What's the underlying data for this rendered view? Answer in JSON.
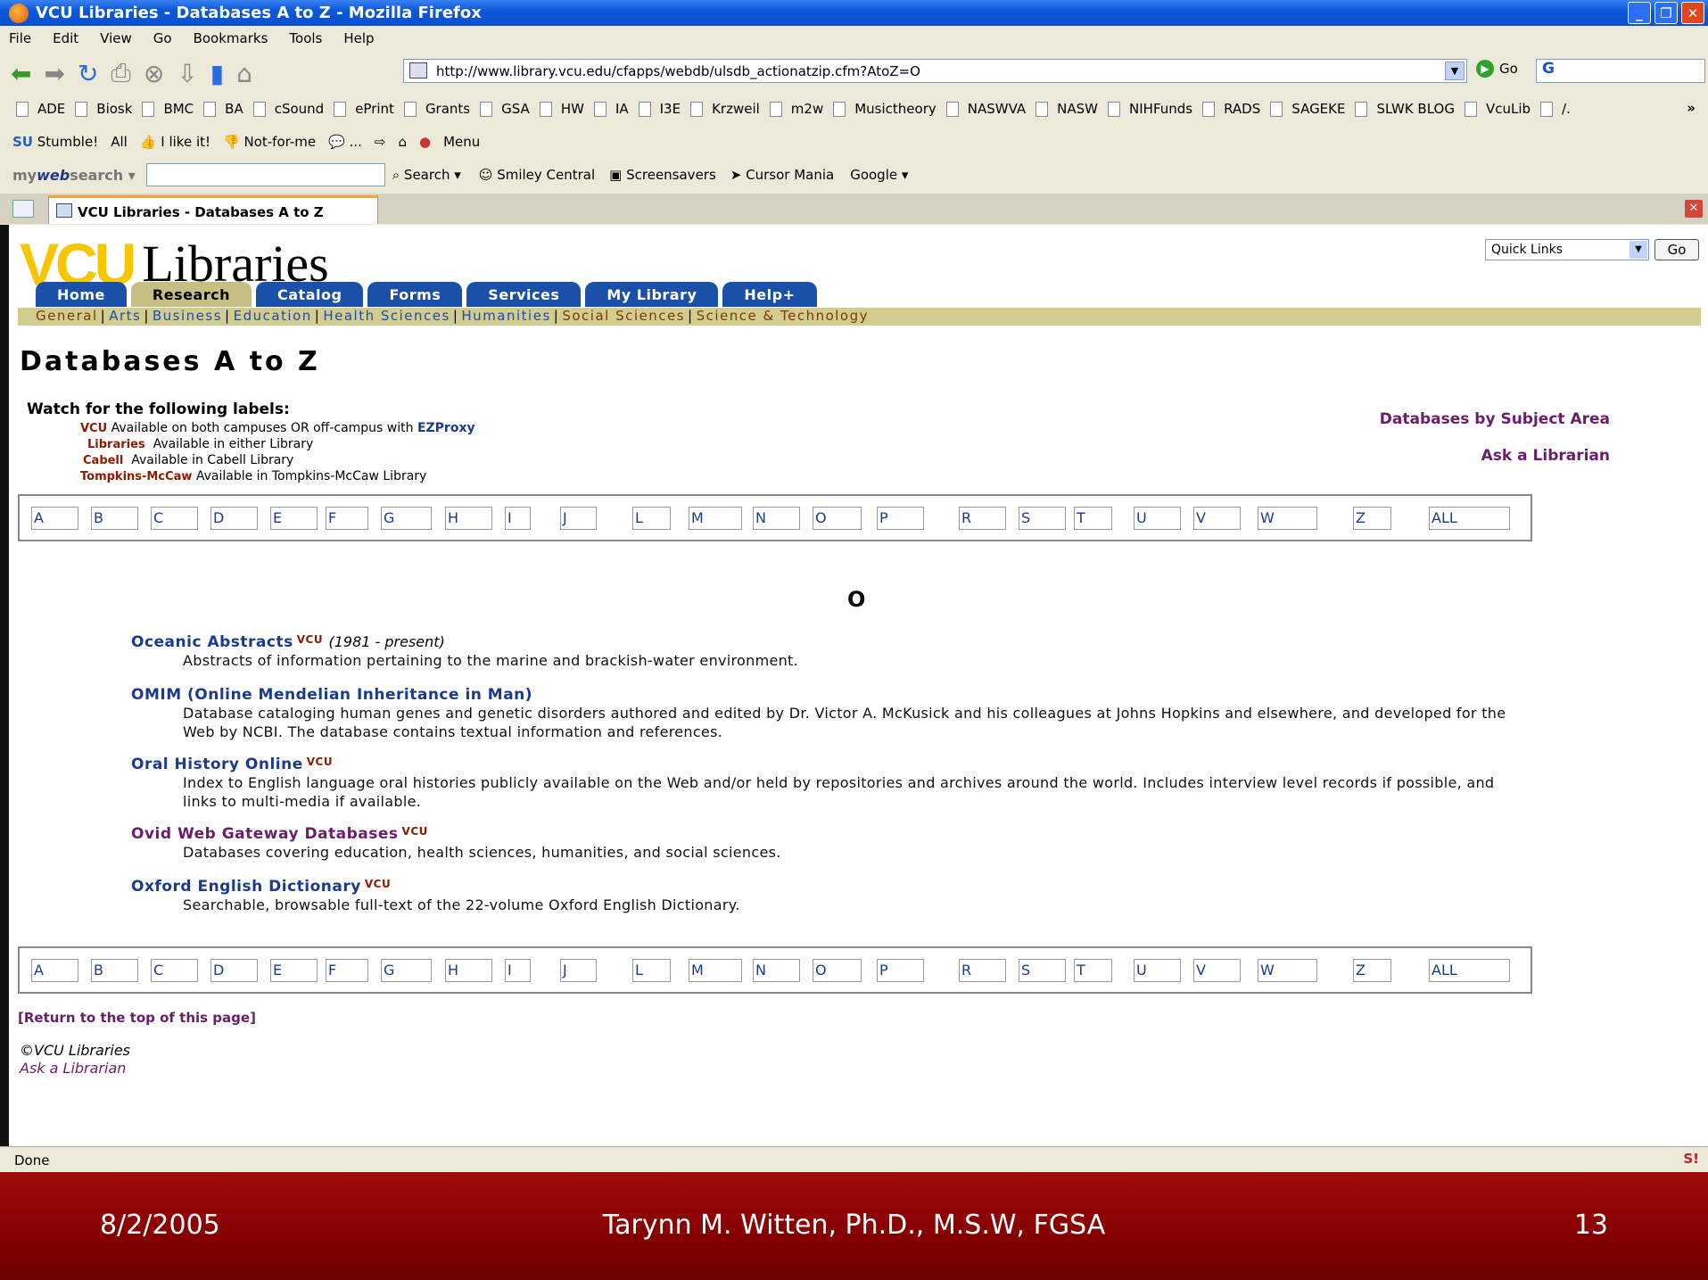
{
  "window": {
    "title": "VCU Libraries - Databases A to Z - Mozilla Firefox"
  },
  "menu": [
    "File",
    "Edit",
    "View",
    "Go",
    "Bookmarks",
    "Tools",
    "Help"
  ],
  "url": "http://www.library.vcu.edu/cfapps/webdb/ulsdb_actionatzip.cfm?AtoZ=O",
  "go_label": "Go",
  "bookmarks": [
    "ADE",
    "Biosk",
    "BMC",
    "BA",
    "cSound",
    "ePrint",
    "Grants",
    "GSA",
    "HW",
    "IA",
    "I3E",
    "Krzweil",
    "m2w",
    "Musictheory",
    "NASWVA",
    "NASW",
    "NIHFunds",
    "RADS",
    "SAGEKE",
    "SLWK BLOG",
    "VcuLib",
    "/."
  ],
  "stumble": {
    "stumble": "Stumble!",
    "all": "All",
    "like": "I like it!",
    "notfor": "Not-for-me",
    "dots": "...",
    "menu": "Menu"
  },
  "websearch": {
    "brand_a": "my",
    "brand_b": "web",
    "brand_c": "search",
    "search": "Search",
    "smiley": "Smiley Central",
    "screensavers": "Screensavers",
    "cursor": "Cursor Mania",
    "google": "Google"
  },
  "tab_title": "VCU Libraries - Databases A to Z",
  "logo": {
    "vcu": "VCU",
    "libraries": "Libraries"
  },
  "quick_links": "Quick Links",
  "quick_go": "Go",
  "nav_tabs": [
    "Home",
    "Research",
    "Catalog",
    "Forms",
    "Services",
    "My Library",
    "Help+"
  ],
  "subnav": [
    "General",
    "Arts",
    "Business",
    "Education",
    "Health Sciences",
    "Humanities",
    "Social Sciences",
    "Science & Technology"
  ],
  "page_title": "Databases A to Z",
  "watch": "Watch for the following labels:",
  "labels": [
    {
      "tag": "VCU",
      "text": "Available on both campuses OR off-campus with ",
      "link": "EZProxy"
    },
    {
      "tag": "Libraries",
      "text": "Available in either Library",
      "link": ""
    },
    {
      "tag": "Cabell",
      "text": "Available in Cabell Library",
      "link": ""
    },
    {
      "tag": "Tompkins-McCaw",
      "text": "Available in Tompkins-McCaw Library",
      "link": ""
    }
  ],
  "side_links": [
    "Databases by Subject Area",
    "Ask a Librarian"
  ],
  "az": [
    "A",
    "B",
    "C",
    "D",
    "E",
    "F",
    "G",
    "H",
    "I",
    "J",
    "L",
    "M",
    "N",
    "O",
    "P",
    "R",
    "S",
    "T",
    "U",
    "V",
    "W",
    "Z",
    "ALL"
  ],
  "letter": "O",
  "entries": [
    {
      "title": "Oceanic Abstracts",
      "tag": "VCU",
      "years": "(1981 - present)",
      "desc": "Abstracts of information pertaining to the marine and brackish-water environment."
    },
    {
      "title": "OMIM (Online Mendelian Inheritance in Man)",
      "tag": "",
      "years": "",
      "desc": "Database cataloging human genes and genetic disorders authored and edited by Dr. Victor A. McKusick and his colleagues at Johns Hopkins and elsewhere, and developed for the Web by NCBI. The database contains textual information and references."
    },
    {
      "title": "Oral History Online",
      "tag": "VCU",
      "years": "",
      "desc": "Index to English language oral histories publicly available on the Web and/or held by repositories and archives around the world. Includes interview level records if possible, and links to multi-media if available."
    },
    {
      "title": "Ovid Web Gateway Databases",
      "tag": "VCU",
      "years": "",
      "desc": "Databases covering education, health sciences, humanities, and social sciences."
    },
    {
      "title": "Oxford English Dictionary",
      "tag": "VCU",
      "years": "",
      "desc": "Searchable, browsable full-text of the 22-volume Oxford English Dictionary."
    }
  ],
  "return_top": "[Return to the top of this page]",
  "copyright": "©VCU Libraries",
  "ask_librarian": "Ask a Librarian",
  "status": "Done",
  "slide_footer": {
    "date": "8/2/2005",
    "author": "Tarynn M. Witten, Ph.D., M.S.W, FGSA",
    "page": "13"
  }
}
